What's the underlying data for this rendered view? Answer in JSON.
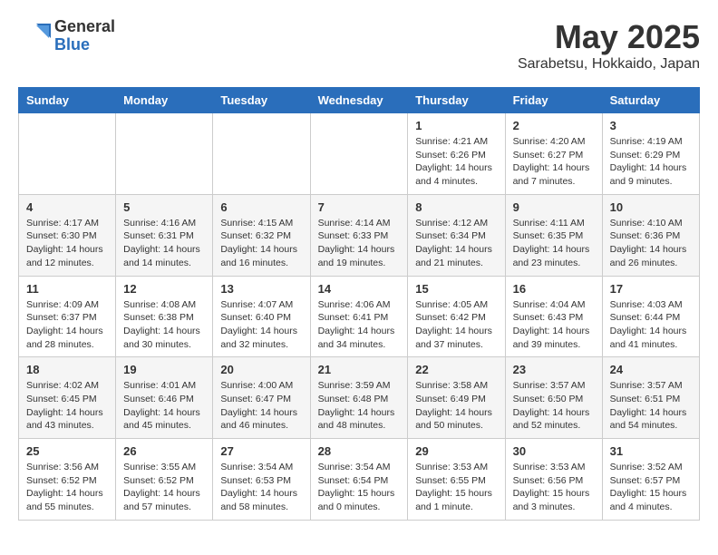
{
  "header": {
    "logo_general": "General",
    "logo_blue": "Blue",
    "title": "May 2025",
    "subtitle": "Sarabetsu, Hokkaido, Japan"
  },
  "days_of_week": [
    "Sunday",
    "Monday",
    "Tuesday",
    "Wednesday",
    "Thursday",
    "Friday",
    "Saturday"
  ],
  "weeks": [
    [
      {
        "day": "",
        "info": ""
      },
      {
        "day": "",
        "info": ""
      },
      {
        "day": "",
        "info": ""
      },
      {
        "day": "",
        "info": ""
      },
      {
        "day": "1",
        "info": "Sunrise: 4:21 AM\nSunset: 6:26 PM\nDaylight: 14 hours\nand 4 minutes."
      },
      {
        "day": "2",
        "info": "Sunrise: 4:20 AM\nSunset: 6:27 PM\nDaylight: 14 hours\nand 7 minutes."
      },
      {
        "day": "3",
        "info": "Sunrise: 4:19 AM\nSunset: 6:29 PM\nDaylight: 14 hours\nand 9 minutes."
      }
    ],
    [
      {
        "day": "4",
        "info": "Sunrise: 4:17 AM\nSunset: 6:30 PM\nDaylight: 14 hours\nand 12 minutes."
      },
      {
        "day": "5",
        "info": "Sunrise: 4:16 AM\nSunset: 6:31 PM\nDaylight: 14 hours\nand 14 minutes."
      },
      {
        "day": "6",
        "info": "Sunrise: 4:15 AM\nSunset: 6:32 PM\nDaylight: 14 hours\nand 16 minutes."
      },
      {
        "day": "7",
        "info": "Sunrise: 4:14 AM\nSunset: 6:33 PM\nDaylight: 14 hours\nand 19 minutes."
      },
      {
        "day": "8",
        "info": "Sunrise: 4:12 AM\nSunset: 6:34 PM\nDaylight: 14 hours\nand 21 minutes."
      },
      {
        "day": "9",
        "info": "Sunrise: 4:11 AM\nSunset: 6:35 PM\nDaylight: 14 hours\nand 23 minutes."
      },
      {
        "day": "10",
        "info": "Sunrise: 4:10 AM\nSunset: 6:36 PM\nDaylight: 14 hours\nand 26 minutes."
      }
    ],
    [
      {
        "day": "11",
        "info": "Sunrise: 4:09 AM\nSunset: 6:37 PM\nDaylight: 14 hours\nand 28 minutes."
      },
      {
        "day": "12",
        "info": "Sunrise: 4:08 AM\nSunset: 6:38 PM\nDaylight: 14 hours\nand 30 minutes."
      },
      {
        "day": "13",
        "info": "Sunrise: 4:07 AM\nSunset: 6:40 PM\nDaylight: 14 hours\nand 32 minutes."
      },
      {
        "day": "14",
        "info": "Sunrise: 4:06 AM\nSunset: 6:41 PM\nDaylight: 14 hours\nand 34 minutes."
      },
      {
        "day": "15",
        "info": "Sunrise: 4:05 AM\nSunset: 6:42 PM\nDaylight: 14 hours\nand 37 minutes."
      },
      {
        "day": "16",
        "info": "Sunrise: 4:04 AM\nSunset: 6:43 PM\nDaylight: 14 hours\nand 39 minutes."
      },
      {
        "day": "17",
        "info": "Sunrise: 4:03 AM\nSunset: 6:44 PM\nDaylight: 14 hours\nand 41 minutes."
      }
    ],
    [
      {
        "day": "18",
        "info": "Sunrise: 4:02 AM\nSunset: 6:45 PM\nDaylight: 14 hours\nand 43 minutes."
      },
      {
        "day": "19",
        "info": "Sunrise: 4:01 AM\nSunset: 6:46 PM\nDaylight: 14 hours\nand 45 minutes."
      },
      {
        "day": "20",
        "info": "Sunrise: 4:00 AM\nSunset: 6:47 PM\nDaylight: 14 hours\nand 46 minutes."
      },
      {
        "day": "21",
        "info": "Sunrise: 3:59 AM\nSunset: 6:48 PM\nDaylight: 14 hours\nand 48 minutes."
      },
      {
        "day": "22",
        "info": "Sunrise: 3:58 AM\nSunset: 6:49 PM\nDaylight: 14 hours\nand 50 minutes."
      },
      {
        "day": "23",
        "info": "Sunrise: 3:57 AM\nSunset: 6:50 PM\nDaylight: 14 hours\nand 52 minutes."
      },
      {
        "day": "24",
        "info": "Sunrise: 3:57 AM\nSunset: 6:51 PM\nDaylight: 14 hours\nand 54 minutes."
      }
    ],
    [
      {
        "day": "25",
        "info": "Sunrise: 3:56 AM\nSunset: 6:52 PM\nDaylight: 14 hours\nand 55 minutes."
      },
      {
        "day": "26",
        "info": "Sunrise: 3:55 AM\nSunset: 6:52 PM\nDaylight: 14 hours\nand 57 minutes."
      },
      {
        "day": "27",
        "info": "Sunrise: 3:54 AM\nSunset: 6:53 PM\nDaylight: 14 hours\nand 58 minutes."
      },
      {
        "day": "28",
        "info": "Sunrise: 3:54 AM\nSunset: 6:54 PM\nDaylight: 15 hours\nand 0 minutes."
      },
      {
        "day": "29",
        "info": "Sunrise: 3:53 AM\nSunset: 6:55 PM\nDaylight: 15 hours\nand 1 minute."
      },
      {
        "day": "30",
        "info": "Sunrise: 3:53 AM\nSunset: 6:56 PM\nDaylight: 15 hours\nand 3 minutes."
      },
      {
        "day": "31",
        "info": "Sunrise: 3:52 AM\nSunset: 6:57 PM\nDaylight: 15 hours\nand 4 minutes."
      }
    ]
  ]
}
